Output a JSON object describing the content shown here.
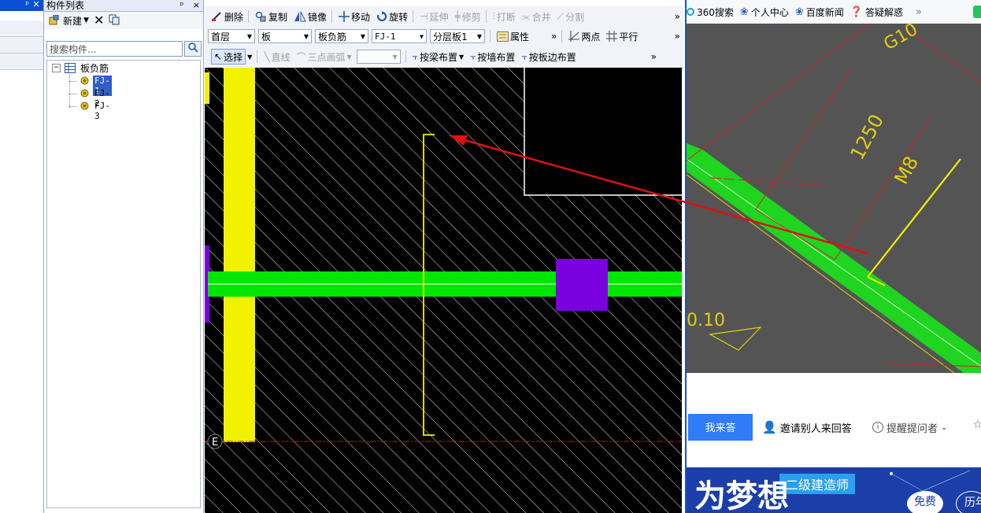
{
  "left_panel": {
    "close_glyph": "×",
    "pin_glyph": "ᵖ"
  },
  "component_panel": {
    "title": "构件列表",
    "pin_glyph": "ᵖ",
    "close_glyph": "×",
    "new_label": "新建",
    "search_placeholder": "搜索构件...",
    "tree": {
      "root_label": "板负筋",
      "expand_glyph": "−",
      "items": [
        "FJ-1",
        "FJ-2",
        "FJ-3"
      ],
      "selected": "FJ-1"
    }
  },
  "cad_toolbar": {
    "row1": {
      "delete": "删除",
      "copy": "复制",
      "mirror": "镜像",
      "move": "移动",
      "rotate": "旋转",
      "extend": "延伸",
      "trim": "修剪",
      "break": "打断",
      "merge": "合并",
      "split": "分割",
      "more": "»"
    },
    "row2": {
      "floor": "首层",
      "category": "板",
      "type": "板负筋",
      "component": "FJ-1",
      "layer": "分层板1",
      "properties": "属性",
      "more1": "»",
      "two_points": "两点",
      "parallel": "平行",
      "more2": "»"
    },
    "row3": {
      "select": "选择",
      "line": "直线",
      "three_point_arc": "三点画弧",
      "by_beam": "按梁布置",
      "by_wall": "按墙布置",
      "by_slab_edge": "按板边布置",
      "more": "»"
    }
  },
  "cad_canvas": {
    "axis_label": "E"
  },
  "browser": {
    "bookmarks": [
      "360搜索",
      "个人中心",
      "百度新闻",
      "答疑解惑"
    ],
    "more": "»",
    "photo_labels": {
      "g10": "G10",
      "i250": "1250",
      "m8": "M8",
      "elev": "0.10"
    },
    "answer_button": "我来答",
    "invite": "邀请别人来回答",
    "remind": "提醒提问者",
    "banner": {
      "tag": "二级建造师",
      "slogan": "为梦想",
      "free": "免费",
      "history": "历年"
    }
  },
  "colors": {
    "cad_background": "#000000",
    "green_beam": "#00e600",
    "yellow_wall": "#f2f200",
    "purple_column": "#7b00e0",
    "arrow_red": "#e01010",
    "accent_blue": "#2f7cf6"
  }
}
